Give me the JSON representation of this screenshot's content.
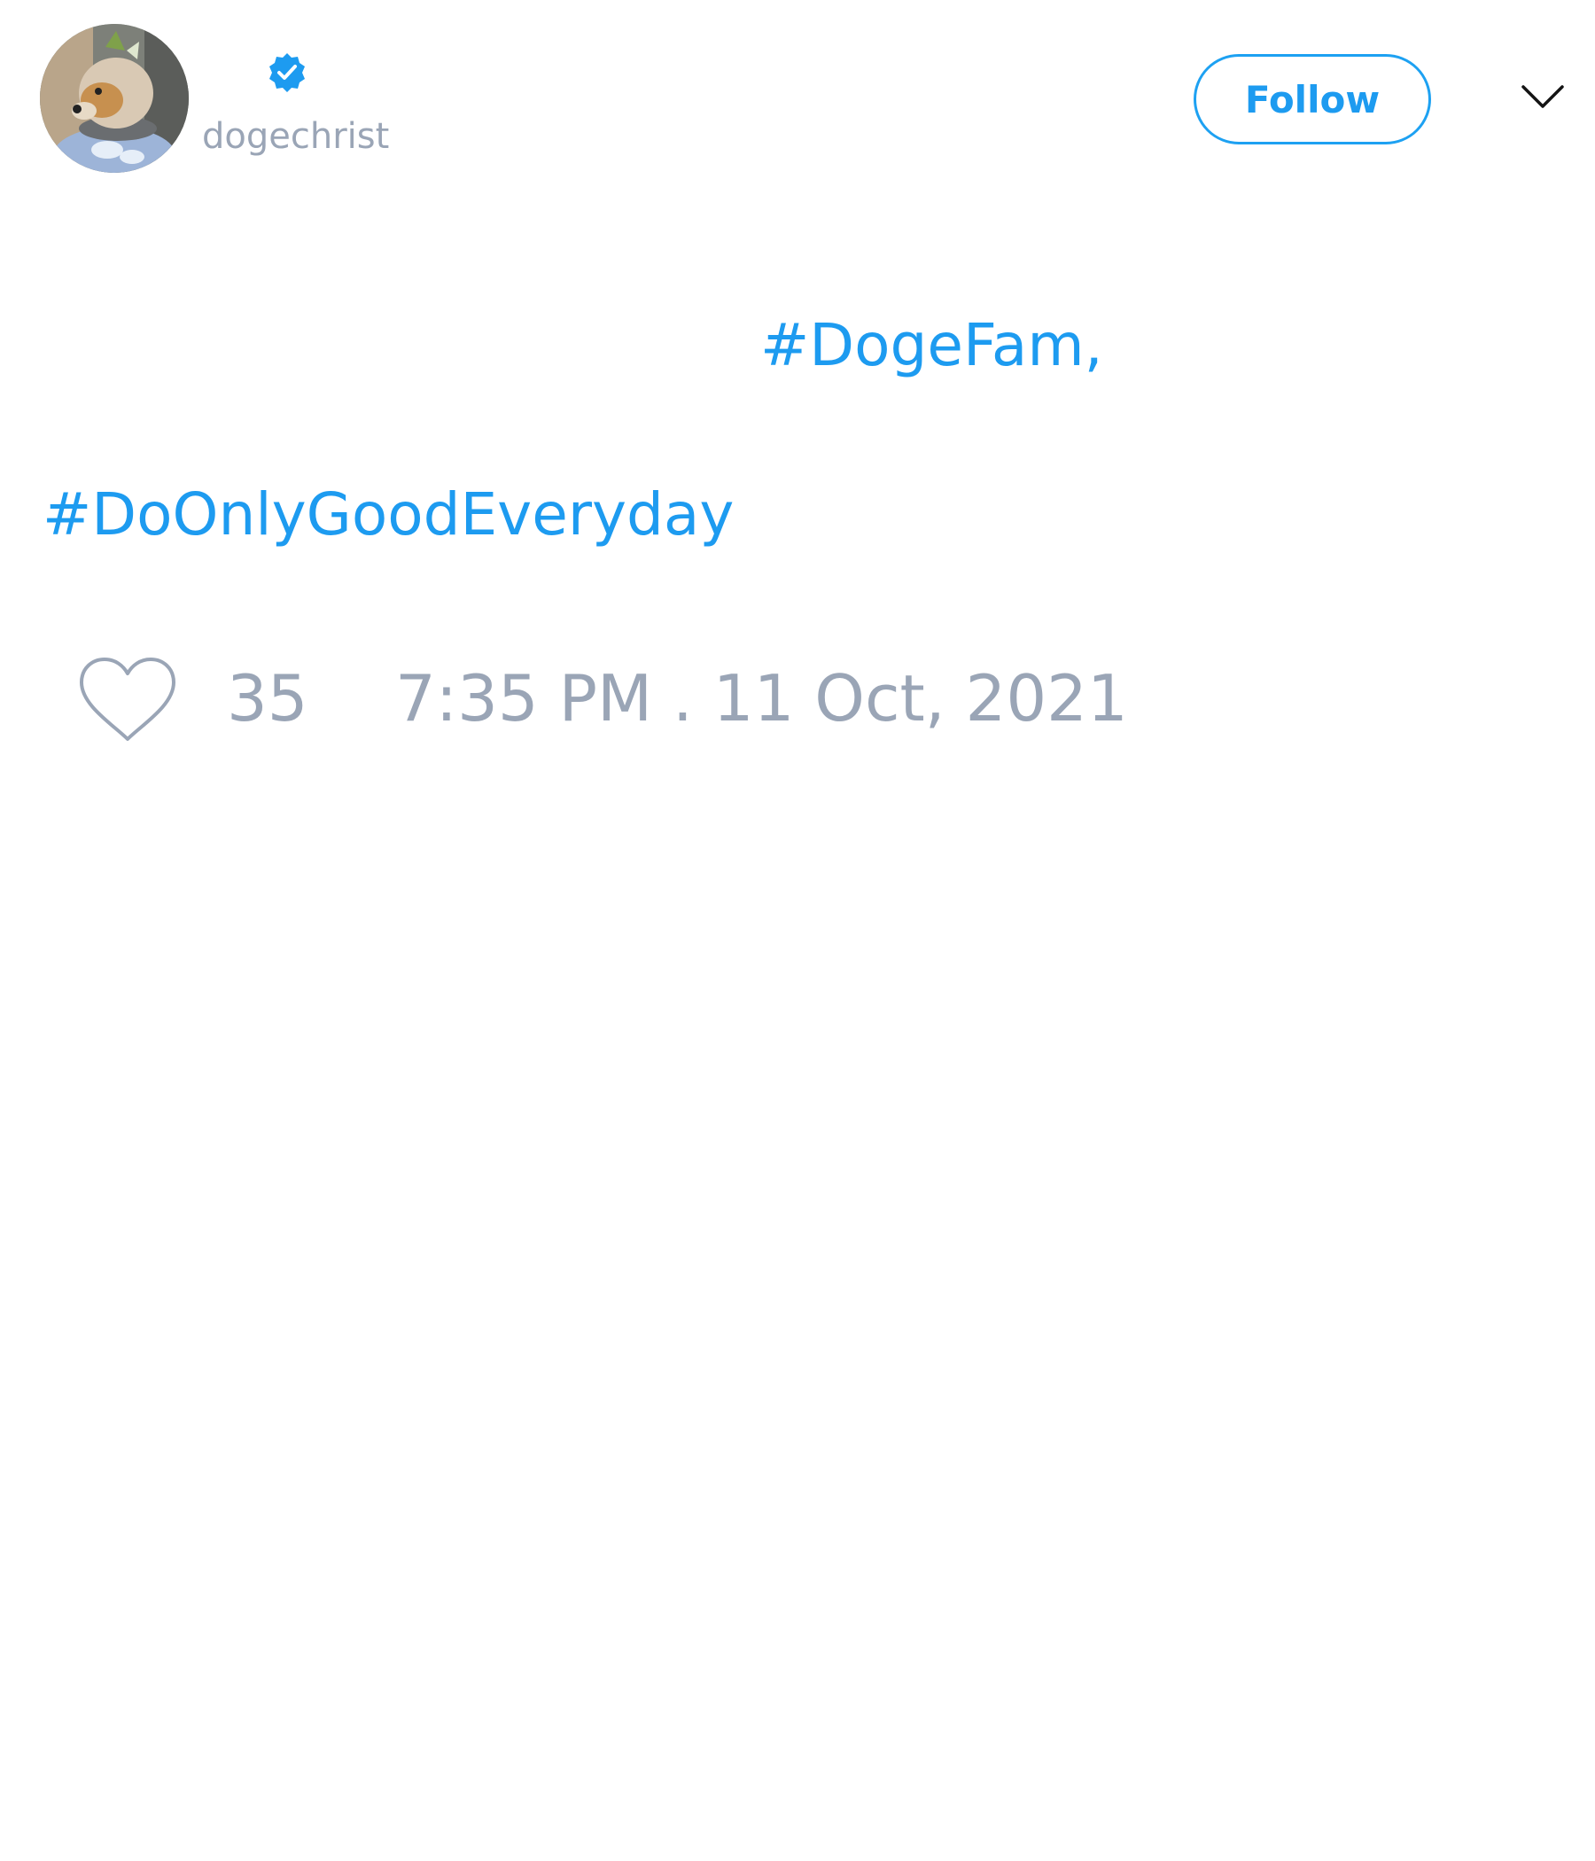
{
  "header": {
    "handle": "dogechrist",
    "follow_label": "Follow",
    "avatar_icon": "doge-avatar",
    "verified_icon": "verified-badge-icon",
    "menu_icon": "chevron-down-icon"
  },
  "tweet": {
    "hashtags": [
      "#DogeFam,",
      "#DoOnlyGoodEveryday"
    ]
  },
  "footer": {
    "like_icon": "heart-icon",
    "like_count": "35",
    "timestamp": "7:35 PM . 11 Oct, 2021"
  },
  "colors": {
    "accent": "#1d9bf0",
    "muted_text": "#9aa5b6",
    "background": "#ffffff"
  }
}
